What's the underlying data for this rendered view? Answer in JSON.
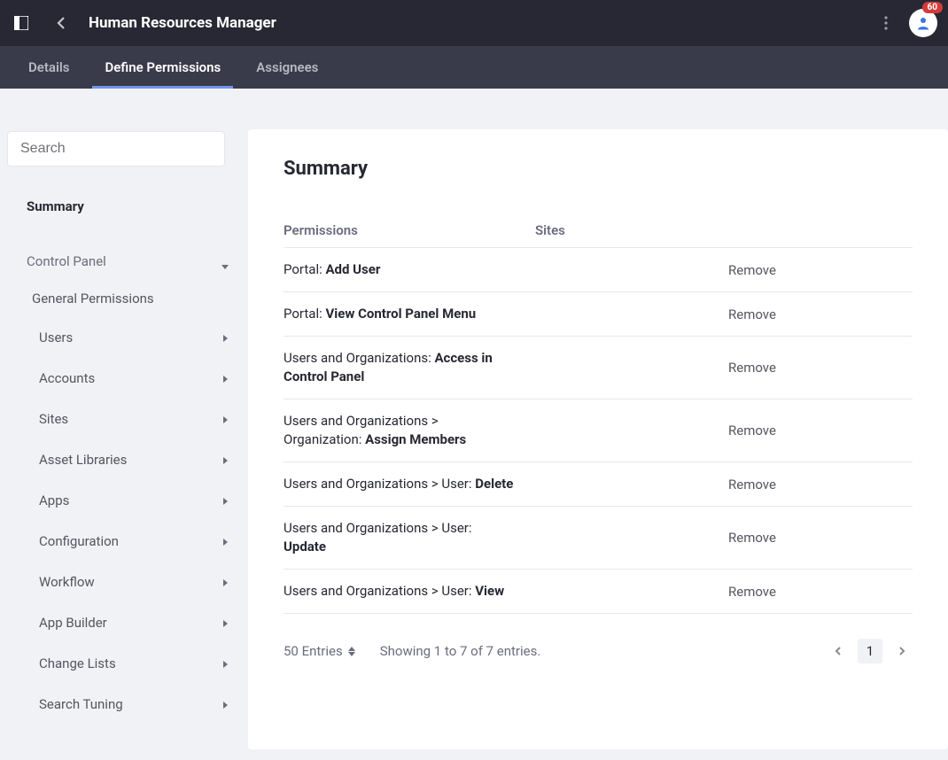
{
  "header": {
    "title": "Human Resources Manager",
    "badge_count": "60"
  },
  "tabs": [
    {
      "label": "Details",
      "active": false
    },
    {
      "label": "Define Permissions",
      "active": true
    },
    {
      "label": "Assignees",
      "active": false
    }
  ],
  "sidebar": {
    "search_placeholder": "Search",
    "summary_label": "Summary",
    "group": {
      "label": "Control Panel",
      "general_permissions": "General Permissions",
      "items": [
        "Users",
        "Accounts",
        "Sites",
        "Asset Libraries",
        "Apps",
        "Configuration",
        "Workflow",
        "App Builder",
        "Change Lists",
        "Search Tuning"
      ]
    }
  },
  "summary": {
    "title": "Summary",
    "columns": {
      "permissions": "Permissions",
      "sites": "Sites"
    },
    "rows": [
      {
        "prefix": "Portal: ",
        "perm": "Add User"
      },
      {
        "prefix": "Portal: ",
        "perm": "View Control Panel Menu"
      },
      {
        "prefix": "Users and Organizations: ",
        "perm": "Access in Control Panel"
      },
      {
        "prefix": "Users and Organizations > Organization: ",
        "perm": "Assign Members"
      },
      {
        "prefix": "Users and Organizations > User: ",
        "perm": "Delete"
      },
      {
        "prefix": "Users and Organizations > User: ",
        "perm": "Update"
      },
      {
        "prefix": "Users and Organizations > User: ",
        "perm": "View"
      }
    ],
    "remove_label": "Remove",
    "pagination": {
      "entries_label": "50 Entries",
      "showing": "Showing 1 to 7 of 7 entries.",
      "current_page": "1"
    }
  }
}
